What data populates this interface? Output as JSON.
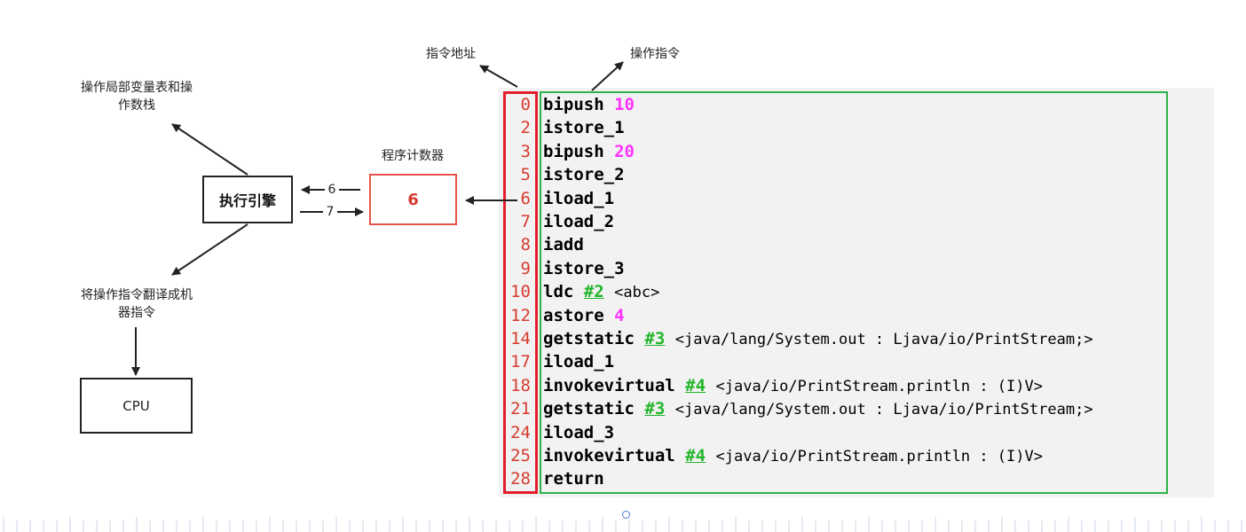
{
  "labels": {
    "addr_label": "指令地址",
    "op_label": "操作指令",
    "locals_label_line1": "操作局部变量表和操",
    "locals_label_line2": "作数栈",
    "pc_title": "程序计数器",
    "translate_label_line1": "将操作指令翻译成机",
    "translate_label_line2": "器指令"
  },
  "boxes": {
    "engine": "执行引擎",
    "pc_value": "6",
    "cpu": "CPU"
  },
  "arrows": {
    "to_engine": "6",
    "from_engine": "7"
  },
  "colors": {
    "address_frame": "#e21e2d",
    "instruction_frame": "#2eb24a",
    "pc_frame": "#e5524a",
    "number_literal": "#ff33ff",
    "constant_ref": "#22b52a",
    "address_text": "#d63b2f"
  },
  "bytecode": [
    {
      "addr": "0",
      "op": "bipush",
      "num": "10"
    },
    {
      "addr": "2",
      "op": "istore_1"
    },
    {
      "addr": "3",
      "op": "bipush",
      "num": "20"
    },
    {
      "addr": "5",
      "op": "istore_2"
    },
    {
      "addr": "6",
      "op": "iload_1"
    },
    {
      "addr": "7",
      "op": "iload_2"
    },
    {
      "addr": "8",
      "op": "iadd"
    },
    {
      "addr": "9",
      "op": "istore_3"
    },
    {
      "addr": "10",
      "op": "ldc",
      "ref": "#2",
      "comment": "<abc>"
    },
    {
      "addr": "12",
      "op": "astore",
      "num": "4"
    },
    {
      "addr": "14",
      "op": "getstatic",
      "ref": "#3",
      "comment": "<java/lang/System.out : Ljava/io/PrintStream;>"
    },
    {
      "addr": "17",
      "op": "iload_1"
    },
    {
      "addr": "18",
      "op": "invokevirtual",
      "ref": "#4",
      "comment": "<java/io/PrintStream.println : (I)V>"
    },
    {
      "addr": "21",
      "op": "getstatic",
      "ref": "#3",
      "comment": "<java/lang/System.out : Ljava/io/PrintStream;>"
    },
    {
      "addr": "24",
      "op": "iload_3"
    },
    {
      "addr": "25",
      "op": "invokevirtual",
      "ref": "#4",
      "comment": "<java/io/PrintStream.println : (I)V>"
    },
    {
      "addr": "28",
      "op": "return"
    }
  ]
}
